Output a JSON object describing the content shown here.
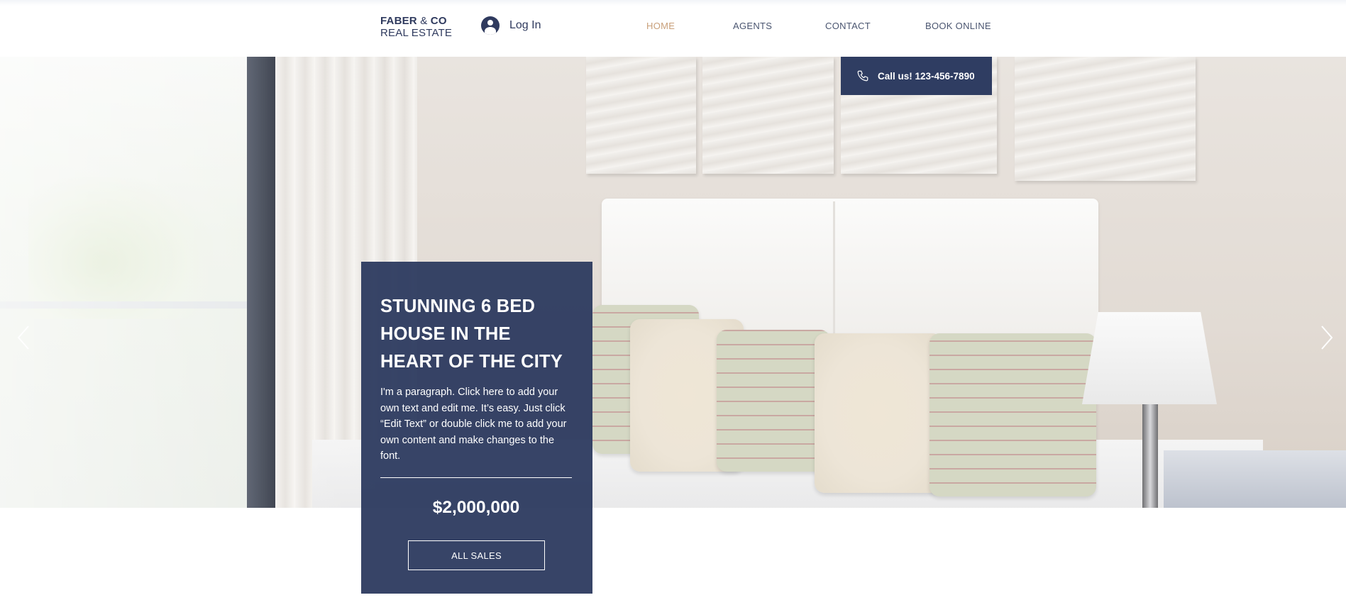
{
  "header": {
    "logo": {
      "line1_bold": "FABER",
      "line1_amp": " & ",
      "line1_end": "CO",
      "line2": "REAL ESTATE"
    },
    "login": {
      "label": "Log In",
      "icon": "user-avatar-icon"
    },
    "nav": [
      {
        "label": "HOME",
        "active": true
      },
      {
        "label": "AGENTS",
        "active": false
      },
      {
        "label": "CONTACT",
        "active": false
      },
      {
        "label": "BOOK ONLINE",
        "active": false
      }
    ]
  },
  "call_box": {
    "label": "Call us! 123-456-7890",
    "icon": "phone-icon"
  },
  "slideshow": {
    "prev_icon": "chevron-left-icon",
    "next_icon": "chevron-right-icon"
  },
  "listing": {
    "title": "STUNNING 6 BED HOUSE IN THE HEART OF THE CITY",
    "paragraph": "I'm a paragraph. Click here to add your own text and edit me. It’s easy. Just click “Edit Text” or double click me to add your own content and make changes to the font.",
    "price": "$2,000,000",
    "button_label": "ALL SALES"
  },
  "colors": {
    "navy": "#2f3d62",
    "nav_active": "#c9a07a",
    "nav_text": "#4a5570",
    "white": "#ffffff"
  }
}
